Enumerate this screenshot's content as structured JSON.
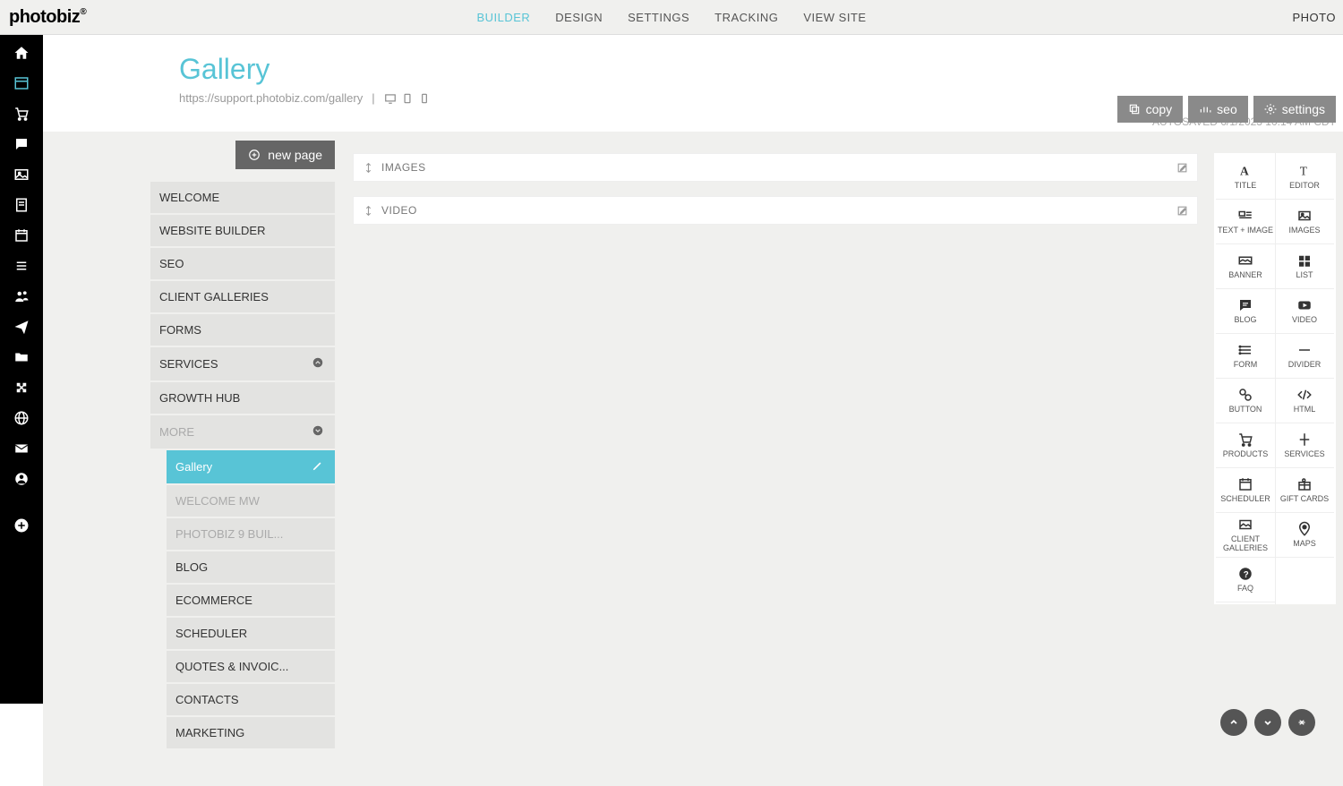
{
  "logo": "photobiz",
  "topnav": {
    "builder": "BUILDER",
    "design": "DESIGN",
    "settings": "SETTINGS",
    "tracking": "TRACKING",
    "viewsite": "VIEW SITE"
  },
  "topright": "PHOTO",
  "page": {
    "title": "Gallery",
    "url": "https://support.photobiz.com/gallery"
  },
  "buttons": {
    "copy": "copy",
    "seo": "seo",
    "settings": "settings",
    "newpage": "new page"
  },
  "autosave": "AUTOSAVED 6/1/2023 10:14 AM CDT",
  "pages": {
    "welcome": "WELCOME",
    "website_builder": "WEBSITE BUILDER",
    "seo": "SEO",
    "client_galleries": "CLIENT GALLERIES",
    "forms": "FORMS",
    "services": "SERVICES",
    "growth_hub": "GROWTH HUB",
    "more": "MORE",
    "gallery": "Gallery",
    "welcome_mw": "WELCOME MW",
    "pb9": "PHOTOBIZ 9 BUIL...",
    "blog": "BLOG",
    "ecommerce": "ECOMMERCE",
    "scheduler": "SCHEDULER",
    "quotes": "QUOTES & INVOIC...",
    "contacts": "CONTACTS",
    "marketing": "MARKETING"
  },
  "blocks": {
    "images": "IMAGES",
    "video": "VIDEO"
  },
  "elements": {
    "title": "TITLE",
    "editor": "EDITOR",
    "textimage": "TEXT + IMAGE",
    "images": "IMAGES",
    "banner": "BANNER",
    "list": "LIST",
    "blog": "BLOG",
    "video": "VIDEO",
    "form": "FORM",
    "divider": "DIVIDER",
    "button": "BUTTON",
    "html": "HTML",
    "products": "PRODUCTS",
    "servicesEl": "SERVICES",
    "schedulerEl": "SCHEDULER",
    "giftcards": "GIFT CARDS",
    "clientgal": "CLIENT GALLERIES",
    "maps": "MAPS",
    "faq": "FAQ"
  }
}
